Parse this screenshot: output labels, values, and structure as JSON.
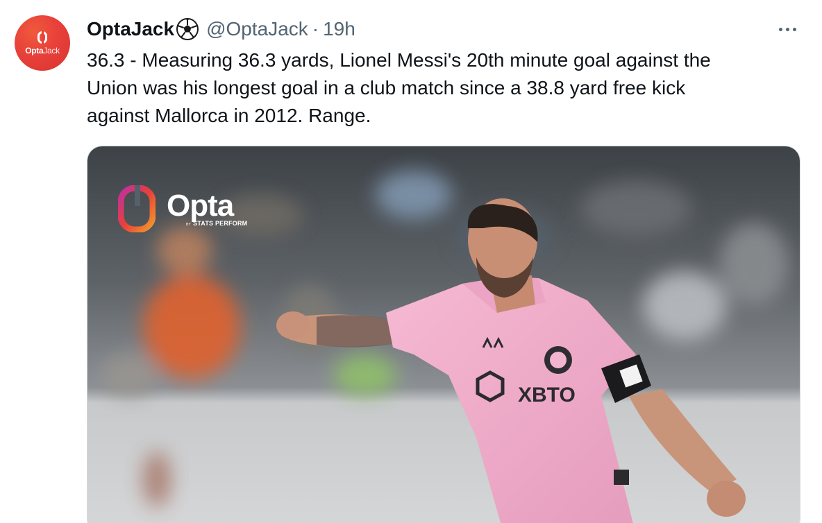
{
  "tweet": {
    "avatar_text": {
      "brand": "Opta",
      "suffix": "Jack"
    },
    "display_name": "OptaJack",
    "handle": "@OptaJack",
    "separator": "·",
    "time": "19h",
    "text_lines": [
      "36.3 - Measuring 36.3 yards, Lionel Messi's 20th minute goal against the",
      "Union was his longest goal in a club match since a 38.8 yard free kick",
      "against Mallorca in 2012. Range."
    ]
  },
  "media": {
    "logo": {
      "word": "Opta",
      "by": "BY",
      "tagline": "STATS PERFORM"
    },
    "sponsor": "XBTO"
  },
  "colors": {
    "text_primary": "#0f1419",
    "text_secondary": "#536471",
    "avatar_bg": "#e8403a",
    "jersey_pink": "#f2a8c8"
  },
  "icons": [
    "soccer-ball-icon",
    "more-icon",
    "opta-logo-icon"
  ]
}
